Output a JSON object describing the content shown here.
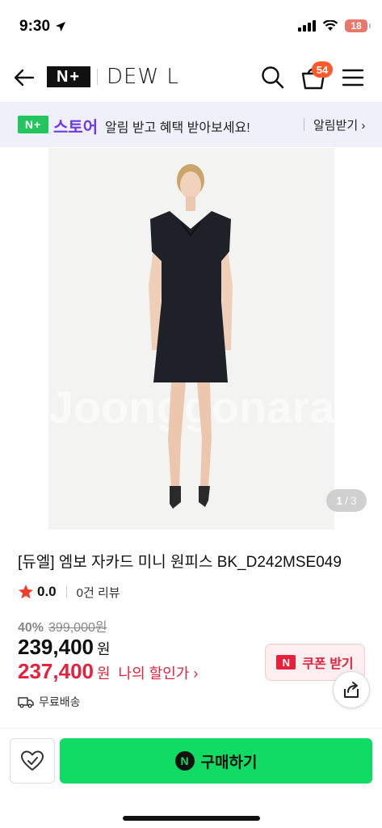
{
  "status": {
    "time": "9:30",
    "battery": "18"
  },
  "header": {
    "logo": "N+",
    "brand": "DEW L",
    "cart_count": "54"
  },
  "notice": {
    "store_badge": "N+",
    "store_label": "스토어",
    "message": "알림 받고 혜택 받아보세요!",
    "action": "알림받기 ›"
  },
  "gallery": {
    "current": "1",
    "separator": "/",
    "total": "3",
    "watermark": "Joonggonara"
  },
  "product": {
    "title": "[듀엘] 엠보 자카드 미니 원피스 BK_D242MSE049",
    "rating": "0.0",
    "review_count": "0건 리뷰",
    "discount_rate": "40%",
    "original_price": "399,000원",
    "sale_price": "239,400",
    "price_unit": "원",
    "my_price": "237,400",
    "my_price_unit": "원",
    "my_price_label": "나의 할인가 ›",
    "shipping": "무료배송"
  },
  "coupon": {
    "logo": "N",
    "label": "쿠폰 받기"
  },
  "bottom": {
    "buy_logo": "N",
    "buy_label": "구매하기"
  },
  "colors": {
    "accent_green": "#10dc63",
    "price_red": "#e5213b",
    "store_purple": "#6d3ae8",
    "badge_orange": "#ff5a2b"
  }
}
